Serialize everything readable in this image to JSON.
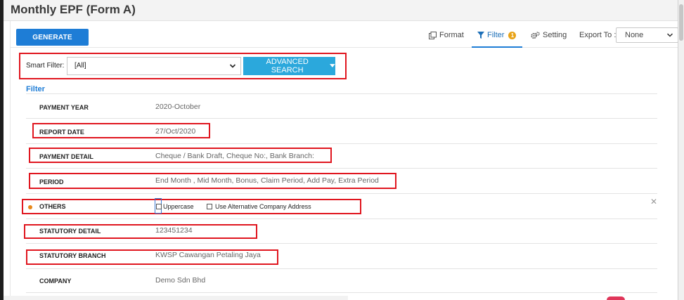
{
  "page": {
    "title": "Monthly EPF (Form A)"
  },
  "toolbar": {
    "generate_label": "GENERATE",
    "format_label": "Format",
    "filter_label": "Filter",
    "filter_badge": "1",
    "setting_label": "Setting",
    "export_label": "Export To :",
    "export_value": "None"
  },
  "smart_filter": {
    "label": "Smart Filter:",
    "value": "[All]",
    "advanced_label": "ADVANCED SEARCH"
  },
  "filter": {
    "heading": "Filter",
    "rows": [
      {
        "label": "PAYMENT YEAR",
        "value": "2020-October"
      },
      {
        "label": "REPORT DATE",
        "value": "27/Oct/2020"
      },
      {
        "label": "PAYMENT DETAIL",
        "value": "Cheque / Bank Draft, Cheque No:, Bank Branch:"
      },
      {
        "label": "PERIOD",
        "value": "End Month , Mid Month, Bonus, Claim Period, Add Pay, Extra Period"
      },
      {
        "label": "OTHERS",
        "options": [
          "Uppercase",
          "Use Alternative Company Address"
        ]
      },
      {
        "label": "STATUTORY DETAIL",
        "value": "123451234"
      },
      {
        "label": "STATUTORY BRANCH",
        "value": "KWSP Cawangan Petaling Jaya"
      },
      {
        "label": "COMPANY",
        "value": "Demo Sdn Bhd"
      }
    ]
  },
  "colors": {
    "primary": "#1e7dd6",
    "advanced": "#2ba8dc",
    "highlight": "#e0161f",
    "badge": "#e8a317"
  },
  "icons": [
    "format-icon",
    "filter-icon",
    "gear-icon",
    "chevron-down-icon",
    "close-icon"
  ]
}
